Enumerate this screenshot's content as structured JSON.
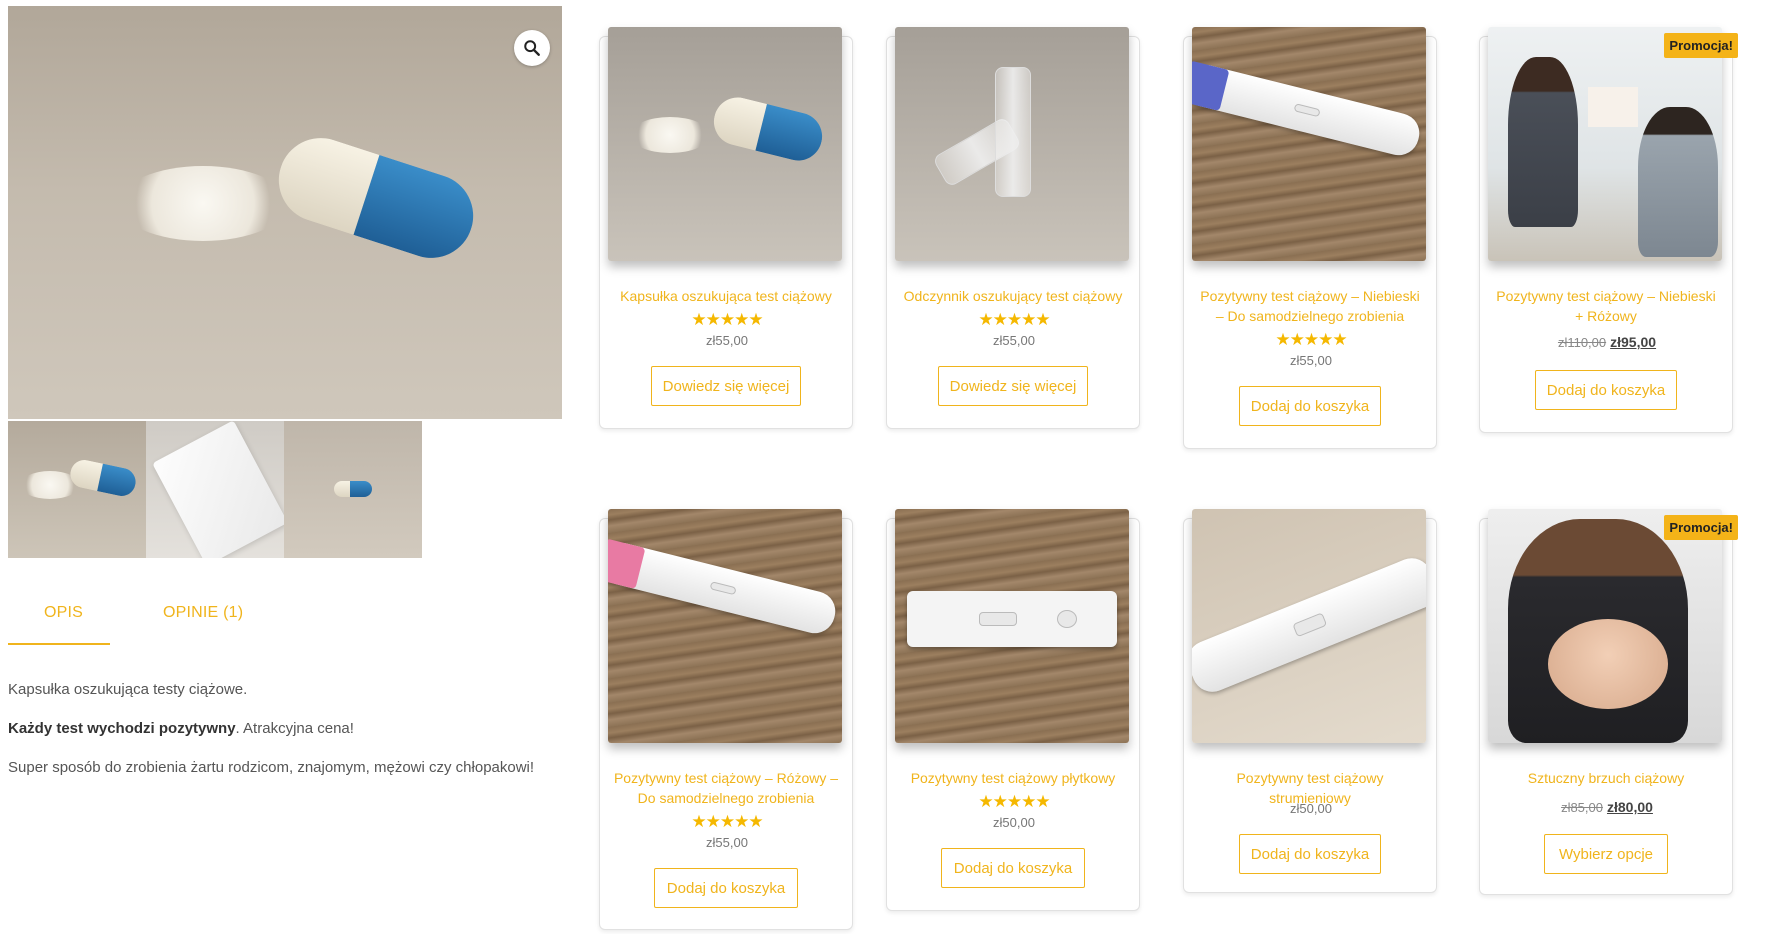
{
  "gallery": {
    "main_image_icon": "capsule-photo",
    "zoom_icon": "magnifier-icon",
    "thumbnails": [
      "capsule-thumb",
      "bag-thumb",
      "small-capsule-thumb"
    ]
  },
  "tabs": {
    "description": "OPIS",
    "reviews": "OPINIE (1)"
  },
  "description": {
    "line1": "Kapsułka oszukująca testy ciążowe.",
    "line2_bold": "Każdy test wychodzi pozytywny",
    "line2_rest": ". Atrakcyjna cena!",
    "line3": "Super sposób do zrobienia żartu rodzicom, znajomym, mężowi czy chłopakowi!"
  },
  "colors": {
    "accent": "#f0b41c",
    "star": "#f5b800",
    "badge": "#f4b318"
  },
  "products": [
    {
      "title": "Kapsułka oszukująca test ciążowy",
      "stars": "★★★★★",
      "price": "zł55,00",
      "button": "Dowiedz się więcej",
      "rating": 5
    },
    {
      "title": "Odczynnik oszukujący test ciążowy",
      "stars": "★★★★★",
      "price": "zł55,00",
      "button": "Dowiedz się więcej",
      "rating": 5
    },
    {
      "title": "Pozytywny test ciążowy – Niebieski – Do samodzielnego zrobienia",
      "stars": "★★★★★",
      "price": "zł55,00",
      "button": "Dodaj do koszyka",
      "rating": 5
    },
    {
      "title": "Pozytywny test ciążowy – Niebieski + Różowy",
      "badge": "Promocja!",
      "price_old": "zł110,00",
      "price_new": "zł95,00",
      "button": "Dodaj do koszyka"
    },
    {
      "title": "Pozytywny test ciążowy – Różowy – Do samodzielnego zrobienia",
      "stars": "★★★★★",
      "price": "zł55,00",
      "button": "Dodaj do koszyka",
      "rating": 5
    },
    {
      "title": "Pozytywny test ciążowy płytkowy",
      "stars": "★★★★★",
      "price": "zł50,00",
      "button": "Dodaj do koszyka",
      "rating": 5
    },
    {
      "title": "Pozytywny test ciążowy strumieniowy",
      "price": "zł50,00",
      "button": "Dodaj do koszyka"
    },
    {
      "title": "Sztuczny brzuch ciążowy",
      "badge": "Promocja!",
      "price_old": "zł85,00",
      "price_new": "zł80,00",
      "button": "Wybierz opcje"
    }
  ]
}
